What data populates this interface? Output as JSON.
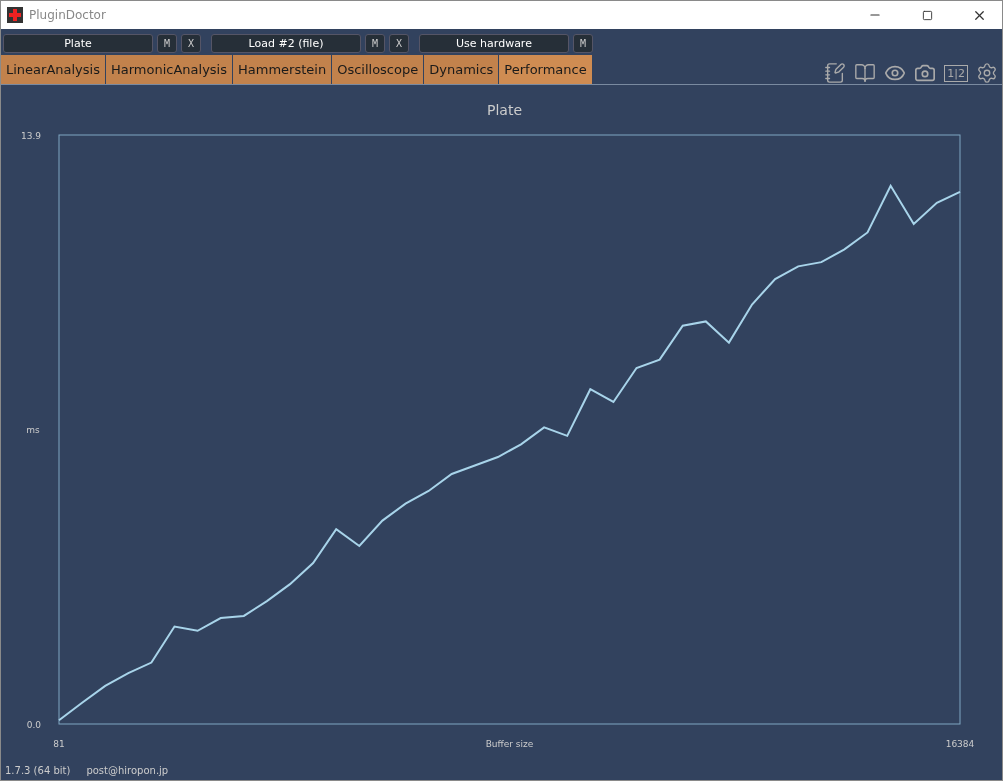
{
  "window": {
    "title": "PluginDoctor"
  },
  "toolbar": [
    {
      "kind": "slot",
      "label": "Plate",
      "buttons": [
        "M",
        "X"
      ]
    },
    {
      "kind": "slot",
      "label": "Load #2 (file)",
      "buttons": [
        "M",
        "X"
      ]
    },
    {
      "kind": "slot",
      "label": "Use hardware",
      "buttons": [
        "M"
      ]
    }
  ],
  "tabs": [
    {
      "label": "LinearAnalysis",
      "selected": false
    },
    {
      "label": "HarmonicAnalysis",
      "selected": false
    },
    {
      "label": "Hammerstein",
      "selected": false
    },
    {
      "label": "Oscilloscope",
      "selected": false
    },
    {
      "label": "Dynamics",
      "selected": false
    },
    {
      "label": "Performance",
      "selected": true
    }
  ],
  "tools": {
    "compare_label": "1|2"
  },
  "chart": {
    "title": "Plate",
    "chart_data": {
      "type": "line",
      "xlabel": "Buffer size",
      "ylabel": "ms",
      "xlim": [
        81,
        16384
      ],
      "ylim": [
        0,
        13.9
      ],
      "xticks": [
        81,
        16384
      ],
      "yticks": [
        {
          "value": 0,
          "label": "0.0"
        },
        {
          "value": 13.9,
          "label": "13.9"
        }
      ],
      "x": [
        81,
        499,
        917,
        1335,
        1753,
        2171,
        2589,
        3007,
        3425,
        3843,
        4261,
        4679,
        5097,
        5515,
        5933,
        6351,
        6769,
        7187,
        7605,
        8023,
        8441,
        8859,
        9277,
        9695,
        10113,
        10531,
        10949,
        11367,
        11785,
        12203,
        12621,
        13039,
        13457,
        13875,
        14293,
        14711,
        15129,
        15547,
        15965,
        16384
      ],
      "series": [
        {
          "color": "#a8d4ea",
          "values": [
            0.09,
            0.5,
            0.9,
            1.2,
            1.45,
            2.3,
            2.2,
            2.5,
            2.55,
            2.9,
            3.3,
            3.8,
            4.6,
            4.2,
            4.8,
            5.2,
            5.5,
            5.9,
            6.1,
            6.3,
            6.6,
            7.0,
            6.8,
            7.9,
            7.6,
            8.4,
            8.6,
            9.4,
            9.5,
            9.0,
            9.9,
            10.5,
            10.8,
            10.9,
            11.2,
            11.6,
            12.7,
            11.8,
            12.3,
            12.56
          ]
        }
      ]
    }
  },
  "status": {
    "version": "1.7.3 (64 bit)",
    "email": "post@hiropon.jp"
  }
}
